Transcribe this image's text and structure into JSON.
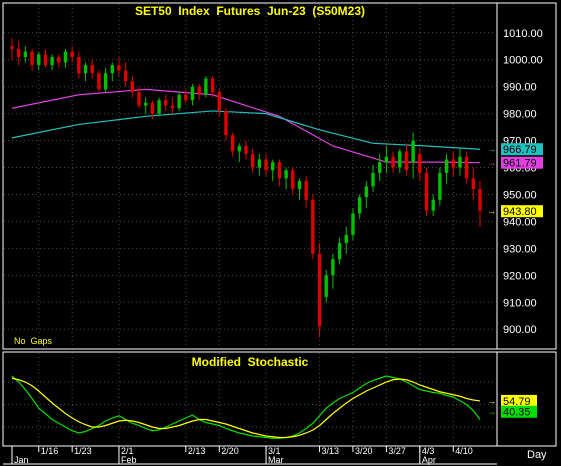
{
  "colors": {
    "background": "#000000",
    "frame": "#ffffff",
    "grid": "#4a4a4a",
    "up_candle": "#00c000",
    "down_candle": "#e00000",
    "ma_fast": "#e040e0",
    "ma_slow": "#20c0c0",
    "title": "#ffff00",
    "stoch_k": "#00e000",
    "stoch_d": "#ffff00",
    "badge_text": "#000000"
  },
  "chart_data": [
    {
      "type": "candlestick",
      "title": "SET50  Index  Futures  Jun-23  (S50M23)",
      "note": "No  Gaps",
      "ylim": [
        896,
        1014
      ],
      "y_ticks": [
        "1010.00",
        "1000.00",
        "990.00",
        "980.00",
        "970.00",
        "960.00",
        "950.00",
        "940.00",
        "930.00",
        "920.00",
        "910.00",
        "900.00"
      ],
      "y_tick_values": [
        1010,
        1000,
        990,
        980,
        970,
        960,
        950,
        940,
        930,
        920,
        910,
        900
      ],
      "x_tick_labels": [
        "1/16",
        "1/23",
        "2/1",
        "2/13",
        "2/20",
        "3/1",
        "3/13",
        "3/20",
        "3/27",
        "4/3",
        "4/10"
      ],
      "x_tick_index": [
        4,
        9,
        16,
        26,
        31,
        38,
        46,
        51,
        56,
        61,
        66
      ],
      "month_labels": [
        "Jan",
        "Feb",
        "Mar",
        "Apr"
      ],
      "month_index": [
        0,
        16,
        38,
        61
      ],
      "period_label": "Day",
      "candles": [
        [
          1005,
          1008,
          1000,
          1004
        ],
        [
          1004,
          1007,
          998,
          1001
        ],
        [
          1001,
          1005,
          999,
          1003
        ],
        [
          1003,
          1004,
          996,
          998
        ],
        [
          998,
          1003,
          996,
          1002
        ],
        [
          1002,
          1004,
          997,
          998
        ],
        [
          998,
          1002,
          996,
          1001
        ],
        [
          1001,
          1002,
          997,
          999
        ],
        [
          999,
          1004,
          997,
          1003
        ],
        [
          1003,
          1005,
          999,
          1001
        ],
        [
          1001,
          1003,
          993,
          995
        ],
        [
          995,
          999,
          992,
          998
        ],
        [
          998,
          1000,
          993,
          995
        ],
        [
          995,
          996,
          988,
          989
        ],
        [
          989,
          997,
          988,
          995
        ],
        [
          995,
          999,
          992,
          998
        ],
        [
          998,
          1001,
          994,
          996
        ],
        [
          996,
          999,
          990,
          992
        ],
        [
          992,
          994,
          986,
          988
        ],
        [
          988,
          990,
          982,
          983
        ],
        [
          983,
          986,
          980,
          984
        ],
        [
          984,
          985,
          978,
          980
        ],
        [
          980,
          986,
          979,
          985
        ],
        [
          985,
          987,
          981,
          983
        ],
        [
          983,
          986,
          980,
          982
        ],
        [
          982,
          988,
          981,
          987
        ],
        [
          987,
          989,
          984,
          985
        ],
        [
          985,
          991,
          983,
          990
        ],
        [
          990,
          991,
          985,
          987
        ],
        [
          987,
          994,
          986,
          993
        ],
        [
          993,
          994,
          986,
          988
        ],
        [
          988,
          989,
          979,
          981
        ],
        [
          981,
          982,
          970,
          972
        ],
        [
          972,
          973,
          964,
          966
        ],
        [
          966,
          969,
          962,
          968
        ],
        [
          968,
          970,
          963,
          965
        ],
        [
          965,
          967,
          958,
          960
        ],
        [
          960,
          965,
          957,
          963
        ],
        [
          963,
          965,
          957,
          959
        ],
        [
          959,
          963,
          955,
          962
        ],
        [
          962,
          963,
          953,
          956
        ],
        [
          956,
          960,
          952,
          959
        ],
        [
          959,
          960,
          950,
          952
        ],
        [
          952,
          956,
          948,
          955
        ],
        [
          955,
          957,
          945,
          948
        ],
        [
          948,
          950,
          926,
          928
        ],
        [
          928,
          932,
          897,
          901
        ],
        [
          912,
          922,
          910,
          920
        ],
        [
          920,
          928,
          915,
          926
        ],
        [
          926,
          934,
          924,
          932
        ],
        [
          932,
          938,
          928,
          935
        ],
        [
          935,
          945,
          933,
          943
        ],
        [
          943,
          950,
          941,
          949
        ],
        [
          949,
          955,
          945,
          953
        ],
        [
          953,
          961,
          951,
          958
        ],
        [
          958,
          965,
          955,
          962
        ],
        [
          962,
          968,
          958,
          964
        ],
        [
          964,
          966,
          958,
          960
        ],
        [
          960,
          967,
          958,
          966
        ],
        [
          966,
          969,
          957,
          959
        ],
        [
          962,
          973,
          956,
          970
        ],
        [
          965,
          967,
          955,
          958
        ],
        [
          958,
          960,
          942,
          944
        ],
        [
          944,
          950,
          942,
          948
        ],
        [
          948,
          960,
          946,
          958
        ],
        [
          958,
          965,
          954,
          963
        ],
        [
          963,
          966,
          957,
          960
        ],
        [
          960,
          967,
          957,
          964
        ],
        [
          964,
          966,
          954,
          956
        ],
        [
          956,
          960,
          948,
          952
        ],
        [
          952,
          955,
          938,
          944
        ]
      ],
      "moving_averages": [
        {
          "name": "ma_fast",
          "values_at": [
            0,
            10,
            20,
            30,
            40,
            48,
            56,
            64,
            70
          ],
          "values": [
            982,
            987,
            989,
            987,
            979,
            968,
            962,
            962,
            961.79
          ]
        },
        {
          "name": "ma_slow",
          "values_at": [
            0,
            10,
            20,
            30,
            38,
            46,
            54,
            62,
            70
          ],
          "values": [
            971,
            976,
            979,
            981,
            980,
            974,
            969,
            968,
            966.79
          ]
        }
      ],
      "last_value_badges": [
        {
          "value": "966.79",
          "color": "#20c0c0",
          "y": 966.79
        },
        {
          "value": "961.79",
          "color": "#e040e0",
          "y": 961.79
        },
        {
          "value": "943.80",
          "color": "#ffff00",
          "y": 943.8
        }
      ]
    },
    {
      "type": "line",
      "title": "Modified  Stochastic",
      "ylim": [
        0,
        100
      ],
      "series": [
        {
          "name": "K",
          "color": "#00e000",
          "values": [
            88,
            80,
            70,
            58,
            45,
            38,
            30,
            25,
            20,
            15,
            12,
            14,
            18,
            22,
            28,
            32,
            35,
            30,
            25,
            22,
            18,
            15,
            16,
            20,
            24,
            28,
            32,
            36,
            30,
            26,
            24,
            22,
            18,
            15,
            12,
            10,
            8,
            7,
            6,
            5,
            5,
            6,
            8,
            12,
            18,
            25,
            35,
            45,
            52,
            58,
            62,
            66,
            72,
            78,
            82,
            85,
            88,
            86,
            84,
            80,
            75,
            70,
            68,
            66,
            65,
            62,
            60,
            55,
            50,
            42,
            30
          ]
        },
        {
          "name": "D",
          "color": "#ffff00",
          "values": [
            85,
            83,
            80,
            75,
            68,
            60,
            52,
            45,
            38,
            32,
            27,
            23,
            20,
            20,
            22,
            25,
            28,
            29,
            28,
            26,
            23,
            20,
            18,
            18,
            20,
            22,
            25,
            28,
            30,
            30,
            28,
            26,
            24,
            21,
            18,
            15,
            12,
            10,
            8,
            7,
            6,
            6,
            7,
            9,
            12,
            16,
            22,
            30,
            38,
            45,
            52,
            58,
            63,
            68,
            72,
            76,
            80,
            83,
            84,
            83,
            80,
            76,
            73,
            70,
            67,
            65,
            63,
            61,
            58,
            56,
            54.79
          ]
        }
      ],
      "last_value_badges": [
        {
          "value": "54.79",
          "color": "#ffff00",
          "y": 54.79
        },
        {
          "value": "40.35",
          "color": "#00e000",
          "y": 40.35
        }
      ]
    }
  ]
}
